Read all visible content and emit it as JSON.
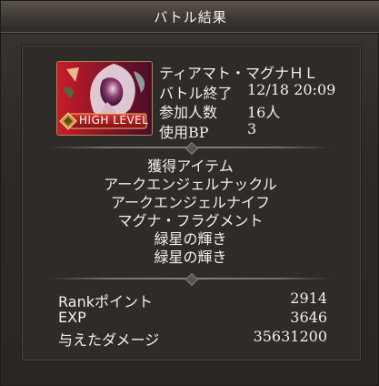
{
  "window": {
    "title": "バトル結果"
  },
  "quest": {
    "name": "ティアマト・マグナＨＬ",
    "badge": "HIGH LEVEL",
    "rows": [
      {
        "label": "バトル終了",
        "value": "12/18 20:09"
      },
      {
        "label": "参加人数",
        "value": "16人"
      },
      {
        "label": "使用BP",
        "value": "3"
      }
    ]
  },
  "items": {
    "heading": "獲得アイテム",
    "list": [
      "アークエンジェルナックル",
      "アークエンジェルナイフ",
      "マグナ・フラグメント",
      "緑星の輝き",
      "緑星の輝き"
    ]
  },
  "stats": [
    {
      "label": "Rankポイント",
      "value": "2914"
    },
    {
      "label": "EXP",
      "value": "3646"
    },
    {
      "label": "与えたダメージ",
      "value": "35631200"
    }
  ],
  "colors": {
    "accent_gold": "#a88a5a",
    "text": "#f2efe9",
    "panel": "#2f2b28"
  },
  "icons": {
    "close": "close-icon",
    "badge": "high-level-badge-icon"
  }
}
